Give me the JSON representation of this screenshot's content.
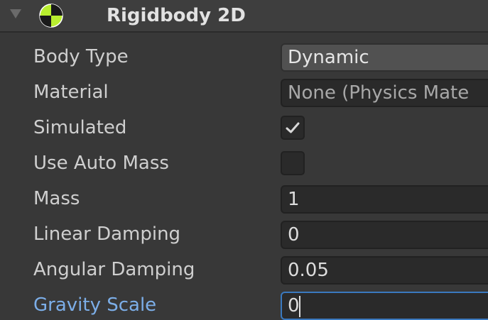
{
  "component": {
    "title": "Rigidbody 2D",
    "icon": "rigidbody2d-icon",
    "expanded": true
  },
  "fields": {
    "body_type": {
      "label": "Body Type",
      "value": "Dynamic"
    },
    "material": {
      "label": "Material",
      "value": "None (Physics Mate"
    },
    "simulated": {
      "label": "Simulated",
      "checked": true
    },
    "use_auto_mass": {
      "label": "Use Auto Mass",
      "checked": false
    },
    "mass": {
      "label": "Mass",
      "value": "1"
    },
    "linear_damping": {
      "label": "Linear Damping",
      "value": "0"
    },
    "angular_damping": {
      "label": "Angular Damping",
      "value": "0.05"
    },
    "gravity_scale": {
      "label": "Gravity Scale",
      "value": "0"
    }
  },
  "colors": {
    "background": "#383838",
    "focused_label": "#7caee8",
    "focus_border": "#3a79bf",
    "icon_green": "#b9ef2f"
  }
}
